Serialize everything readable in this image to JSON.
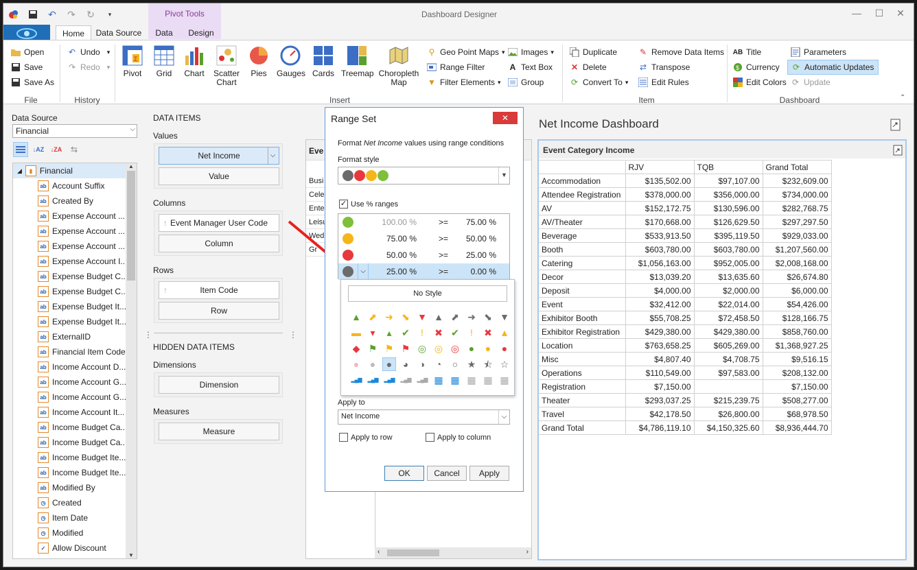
{
  "app": {
    "title": "Dashboard Designer",
    "context_tab": "Pivot Tools"
  },
  "tabs": [
    "Home",
    "Data Source",
    "Data",
    "Design"
  ],
  "ribbon": {
    "file": {
      "open": "Open",
      "save": "Save",
      "save_as": "Save As",
      "group": "File"
    },
    "history": {
      "undo": "Undo",
      "redo": "Redo",
      "group": "History"
    },
    "insert": {
      "pivot": "Pivot",
      "grid": "Grid",
      "chart": "Chart",
      "scatter": "Scatter\nChart",
      "pies": "Pies",
      "gauges": "Gauges",
      "cards": "Cards",
      "treemap": "Treemap",
      "choropleth": "Choropleth\nMap",
      "geo_point_maps": "Geo Point Maps",
      "range_filter": "Range Filter",
      "filter_elements": "Filter Elements",
      "images": "Images",
      "text_box": "Text Box",
      "group_btn": "Group",
      "group": "Insert"
    },
    "item": {
      "duplicate": "Duplicate",
      "delete": "Delete",
      "convert_to": "Convert To",
      "remove_data_items": "Remove Data Items",
      "transpose": "Transpose",
      "edit_rules": "Edit Rules",
      "group": "Item"
    },
    "dashboard": {
      "title": "Title",
      "currency": "Currency",
      "edit_colors": "Edit Colors",
      "parameters": "Parameters",
      "automatic_updates": "Automatic Updates",
      "update": "Update",
      "group": "Dashboard"
    }
  },
  "data_source": {
    "label": "Data Source",
    "value": "Financial",
    "root": "Financial",
    "fields": [
      "Account Suffix",
      "Created By",
      "Expense Account ...",
      "Expense Account ...",
      "Expense Account ...",
      "Expense Account I...",
      "Expense Budget C...",
      "Expense Budget C...",
      "Expense Budget It...",
      "Expense Budget It...",
      "ExternalID",
      "Financial Item Code",
      "Income Account D...",
      "Income Account G...",
      "Income Account G...",
      "Income Account It...",
      "Income Budget Ca...",
      "Income Budget Ca...",
      "Income Budget Ite...",
      "Income Budget Ite...",
      "Modified By",
      "Created",
      "Item Date",
      "Modified",
      "Allow Discount"
    ]
  },
  "data_items": {
    "heading": "DATA ITEMS",
    "values_label": "Values",
    "values_item": "Net Income",
    "values_placeholder": "Value",
    "columns_label": "Columns",
    "columns_item": "Event Manager User Code",
    "columns_placeholder": "Column",
    "rows_label": "Rows",
    "rows_item": "Item Code",
    "rows_placeholder": "Row",
    "hidden_heading": "HIDDEN DATA ITEMS",
    "dimensions_label": "Dimensions",
    "dimensions_placeholder": "Dimension",
    "measures_label": "Measures",
    "measures_placeholder": "Measure"
  },
  "middle_preview": {
    "header": "Eve",
    "rows": [
      "Busi",
      "Cele",
      "Ente",
      "Leisu",
      "Wed",
      "Gr"
    ]
  },
  "dialog": {
    "title": "Range Set",
    "intro_prefix": "Format ",
    "intro_field": "Net Income",
    "intro_suffix": " values using range conditions",
    "format_style_label": "Format style",
    "use_pct_label": "Use % ranges",
    "ranges": [
      {
        "color": "#7fbf3a",
        "from": "100.00 %",
        "op": ">=",
        "to": "75.00 %"
      },
      {
        "color": "#f5b619",
        "from": "75.00 %",
        "op": ">=",
        "to": "50.00 %"
      },
      {
        "color": "#e8383d",
        "from": "50.00 %",
        "op": ">=",
        "to": "25.00 %"
      },
      {
        "color": "#6b6b6b",
        "from": "25.00 %",
        "op": ">=",
        "to": "0.00 %"
      }
    ],
    "no_style": "No Style",
    "apply_to_label": "Apply to",
    "apply_to_value": "Net Income",
    "apply_to_row": "Apply to row",
    "apply_to_column": "Apply to column",
    "ok": "OK",
    "cancel": "Cancel",
    "apply": "Apply"
  },
  "dashboard": {
    "title": "Net Income Dashboard",
    "pivot_title": "Event Category Income",
    "columns": [
      "RJV",
      "TQB",
      "Grand Total"
    ],
    "rows": [
      [
        "Accommodation",
        "$135,502.00",
        "$97,107.00",
        "$232,609.00"
      ],
      [
        "Attendee Registration",
        "$378,000.00",
        "$356,000.00",
        "$734,000.00"
      ],
      [
        "AV",
        "$152,172.75",
        "$130,596.00",
        "$282,768.75"
      ],
      [
        "AV/Theater",
        "$170,668.00",
        "$126,629.50",
        "$297,297.50"
      ],
      [
        "Beverage",
        "$533,913.50",
        "$395,119.50",
        "$929,033.00"
      ],
      [
        "Booth",
        "$603,780.00",
        "$603,780.00",
        "$1,207,560.00"
      ],
      [
        "Catering",
        "$1,056,163.00",
        "$952,005.00",
        "$2,008,168.00"
      ],
      [
        "Decor",
        "$13,039.20",
        "$13,635.60",
        "$26,674.80"
      ],
      [
        "Deposit",
        "$4,000.00",
        "$2,000.00",
        "$6,000.00"
      ],
      [
        "Event",
        "$32,412.00",
        "$22,014.00",
        "$54,426.00"
      ],
      [
        "Exhibitor Booth",
        "$55,708.25",
        "$72,458.50",
        "$128,166.75"
      ],
      [
        "Exhibitor Registration",
        "$429,380.00",
        "$429,380.00",
        "$858,760.00"
      ],
      [
        "Location",
        "$763,658.25",
        "$605,269.00",
        "$1,368,927.25"
      ],
      [
        "Misc",
        "$4,807.40",
        "$4,708.75",
        "$9,516.15"
      ],
      [
        "Operations",
        "$110,549.00",
        "$97,583.00",
        "$208,132.00"
      ],
      [
        "Registration",
        "$7,150.00",
        "",
        "$7,150.00"
      ],
      [
        "Theater",
        "$293,037.25",
        "$215,239.75",
        "$508,277.00"
      ],
      [
        "Travel",
        "$42,178.50",
        "$26,800.00",
        "$68,978.50"
      ],
      [
        "Grand Total",
        "$4,786,119.10",
        "$4,150,325.60",
        "$8,936,444.70"
      ]
    ]
  },
  "colors": {
    "accent": "#1e6fb8",
    "dialog_border": "#5b9bd5",
    "close_red": "#d93a3a",
    "selection": "#cce4f7"
  }
}
